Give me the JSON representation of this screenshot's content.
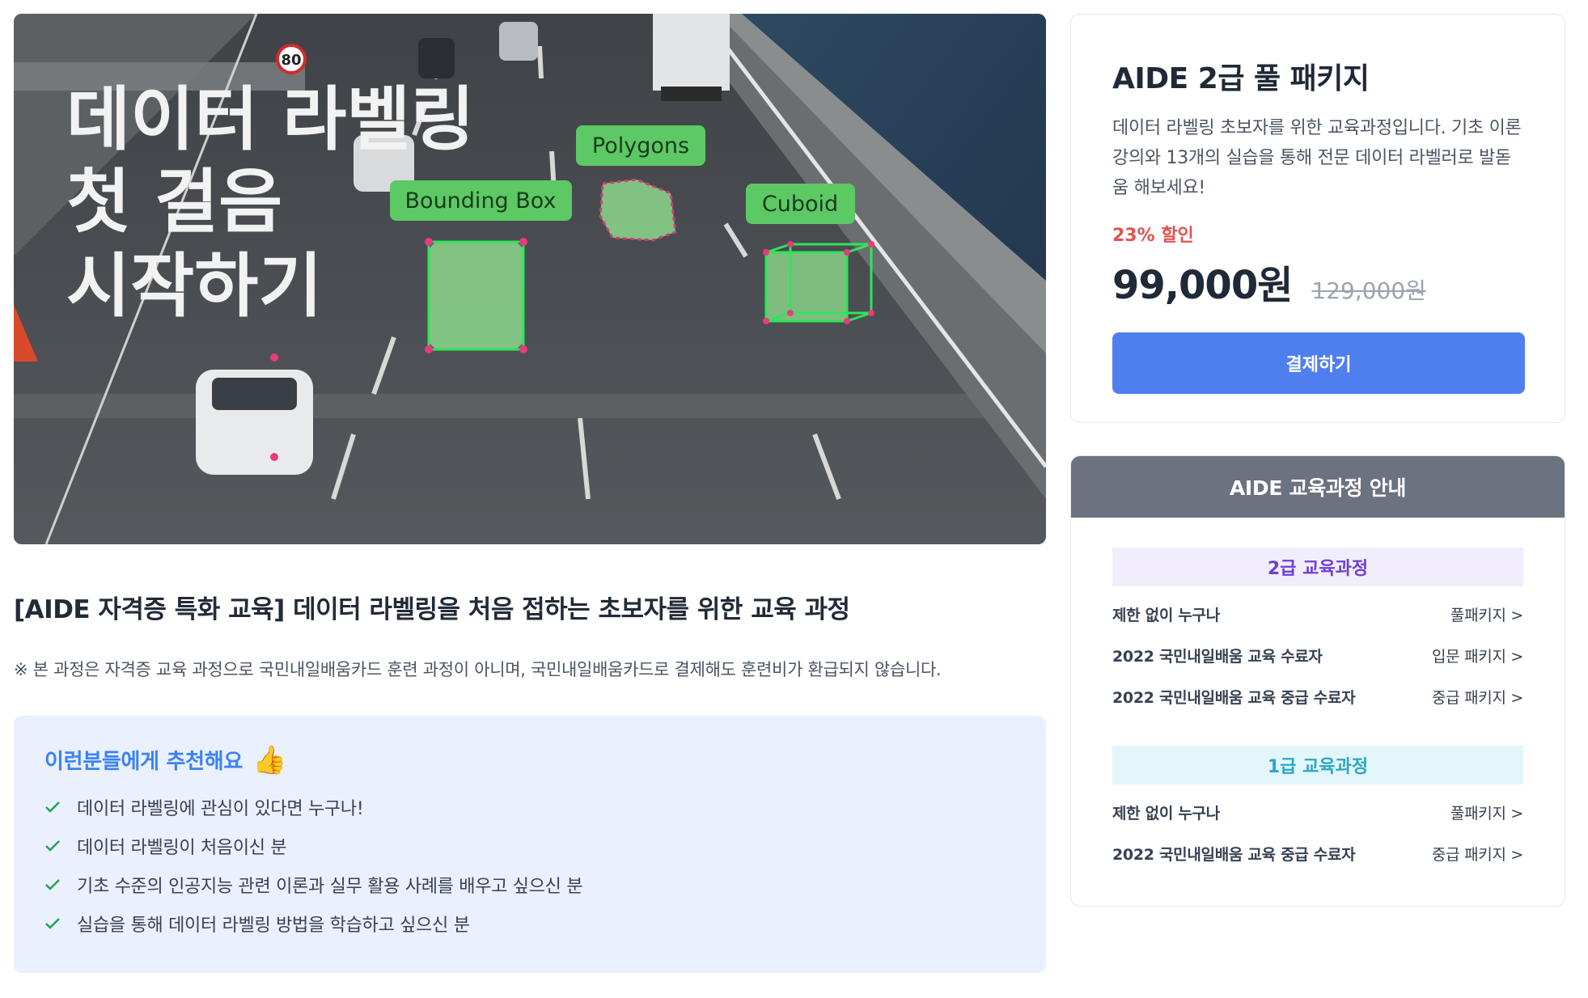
{
  "hero": {
    "headline": [
      "데이터 라벨링",
      "첫 걸음",
      "시작하기"
    ],
    "tags": [
      "Polygons",
      "Bounding Box",
      "Cuboid"
    ],
    "speed_sign": "80"
  },
  "course": {
    "title": "[AIDE 자격증 특화 교육] 데이터 라벨링을 처음 접하는 초보자를 위한 교육 과정",
    "notice": "※ 본 과정은 자격증 교육 과정으로 국민내일배움카드 훈련 과정이 아니며, 국민내일배움카드로 결제해도 훈련비가 환급되지 않습니다."
  },
  "recommend": {
    "title": "이런분들에게 추천해요",
    "icon": "thumbs-up-icon",
    "items": [
      "데이터 라벨링에 관심이 있다면 누구나!",
      "데이터 라벨링이 처음이신 분",
      "기초 수준의 인공지능 관련 이론과 실무 활용 사례를 배우고 싶으신 분",
      "실습을 통해 데이터 라벨링 방법을 학습하고 싶으신 분"
    ]
  },
  "package": {
    "title": "AIDE 2급 풀 패키지",
    "description": "데이터 라벨링 초보자를 위한 교육과정입니다. 기초 이론 강의와 13개의 실습을 통해 전문 데이터 라벨러로 발돋움 해보세요!",
    "discount": "23% 할인",
    "price": "99,000원",
    "original_price": "129,000원",
    "pay_label": "결제하기",
    "accent_color": "#4f7fef"
  },
  "guide": {
    "title": "AIDE 교육과정 안내",
    "levels": [
      {
        "name": "2급 교육과정",
        "bg": "#f1edfd",
        "color": "#6d3fd6",
        "rows": [
          {
            "left": "제한 없이 누구나",
            "right": "풀패키지 >"
          },
          {
            "left": "2022 국민내일배움 교육 수료자",
            "right": "입문 패키지 >"
          },
          {
            "left": "2022 국민내일배움 교육 중급 수료자",
            "right": "중급 패키지 >"
          }
        ]
      },
      {
        "name": "1급 교육과정",
        "bg": "#e3f6fb",
        "color": "#2aa7c4",
        "rows": [
          {
            "left": "제한 없이 누구나",
            "right": "풀패키지 >"
          },
          {
            "left": "2022 국민내일배움 교육 중급 수료자",
            "right": "중급 패키지 >"
          }
        ]
      }
    ]
  }
}
